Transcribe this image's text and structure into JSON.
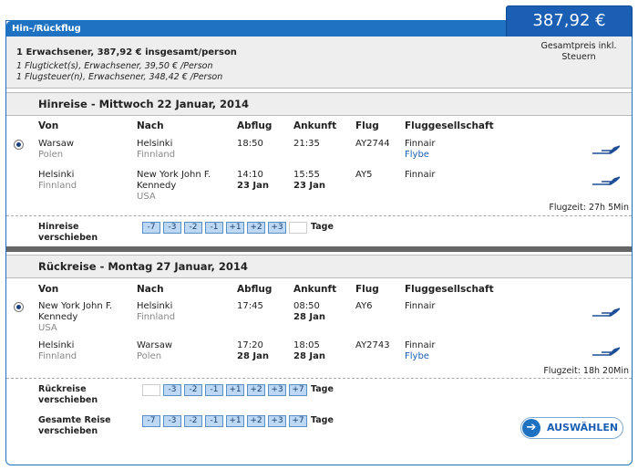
{
  "title_tab": "Hin-/Rückflug",
  "price": {
    "total": "387,92 €",
    "note_line1": "Gesamtpreis inkl.",
    "note_line2": "Steuern"
  },
  "summary": {
    "main": "1 Erwachsener, 387,92 € insgesamt/person",
    "line1": "1 Flugticket(s), Erwachsener, 39,50 € /Person",
    "line2": "1 Flugsteuer(n), Erwachsener, 348,42 € /Person"
  },
  "headers": {
    "von": "Von",
    "nach": "Nach",
    "abflug": "Abflug",
    "ankunft": "Ankunft",
    "flug": "Flug",
    "airline": "Fluggesellschaft"
  },
  "outbound": {
    "title": "Hinreise - Mittwoch 22 Januar, 2014",
    "legs": [
      {
        "from": "Warsaw",
        "from_country": "Polen",
        "to": "Helsinki",
        "to_country": "Finnland",
        "to_extra": "",
        "dep": "18:50",
        "dep_date": "",
        "arr": "21:35",
        "arr_date": "",
        "flight": "AY2744",
        "airline": "Finnair",
        "operated": "Flybe"
      },
      {
        "from": "Helsinki",
        "from_country": "Finnland",
        "to": "New York John F.",
        "to_country": "Kennedy",
        "to_extra": "USA",
        "dep": "14:10",
        "dep_date": "23 Jan",
        "arr": "15:55",
        "arr_date": "23 Jan",
        "flight": "AY5",
        "airline": "Finnair",
        "operated": ""
      }
    ],
    "duration": "Flugzeit: 27h 5Min",
    "shift_label_1": "Hinreise",
    "shift_label_2": "verschieben",
    "shift_buttons": [
      "-7",
      "-3",
      "-2",
      "-1",
      "+1",
      "+2",
      "+3",
      ""
    ],
    "days": "Tage"
  },
  "return": {
    "title": "Rückreise - Montag 27 Januar, 2014",
    "legs": [
      {
        "from": "New York John F.",
        "from_country": "Kennedy",
        "from_extra": "USA",
        "to": "Helsinki",
        "to_country": "Finnland",
        "dep": "17:45",
        "dep_date": "",
        "arr": "08:50",
        "arr_date": "28 Jan",
        "flight": "AY6",
        "airline": "Finnair",
        "operated": ""
      },
      {
        "from": "Helsinki",
        "from_country": "Finnland",
        "from_extra": "",
        "to": "Warsaw",
        "to_country": "Polen",
        "dep": "17:20",
        "dep_date": "28 Jan",
        "arr": "18:05",
        "arr_date": "28 Jan",
        "flight": "AY2743",
        "airline": "Finnair",
        "operated": "Flybe"
      }
    ],
    "duration": "Flugzeit: 18h 20Min",
    "shift_label_1": "Rückreise",
    "shift_label_2": "verschieben",
    "shift_buttons": [
      "",
      "-3",
      "-2",
      "-1",
      "+1",
      "+2",
      "+3",
      "+7"
    ],
    "days": "Tage"
  },
  "total_shift": {
    "label_1": "Gesamte Reise",
    "label_2": "verschieben",
    "buttons": [
      "-7",
      "-3",
      "-2",
      "-1",
      "+1",
      "+2",
      "+3",
      "+7"
    ],
    "days": "Tage"
  },
  "choose_button": "AUSWÄHLEN",
  "colors": {
    "accent": "#1f72c2",
    "price_bg": "#1a5fb4",
    "day_button_bg": "#bcd8f4"
  },
  "icons": {
    "airline_logo": "finnair-logo-icon",
    "choose_arrow": "arrow-right-icon",
    "radio": "radio-selected-icon"
  }
}
